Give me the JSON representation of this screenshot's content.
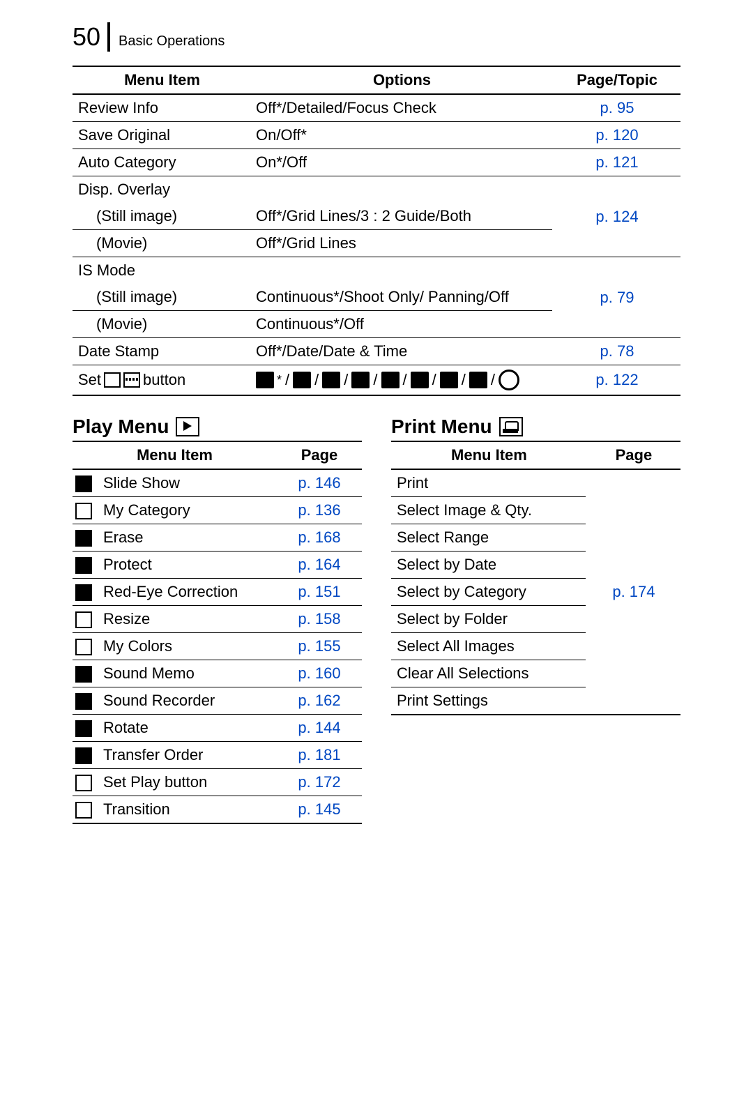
{
  "header": {
    "page_number": "50",
    "section": "Basic Operations"
  },
  "main_table": {
    "columns": [
      "Menu Item",
      "Options",
      "Page/Topic"
    ],
    "rows": [
      {
        "item": "Review Info",
        "options": "Off*/Detailed/Focus Check",
        "page": "p. 95"
      },
      {
        "item": "Save Original",
        "options": "On/Off*",
        "page": "p. 120"
      },
      {
        "item": "Auto Category",
        "options": "On*/Off",
        "page": "p. 121"
      },
      {
        "item": "Disp. Overlay",
        "group": true
      },
      {
        "item": "(Still image)",
        "indent": true,
        "options": "Off*/Grid Lines/3 : 2 Guide/Both",
        "page": "p. 124"
      },
      {
        "item": "(Movie)",
        "indent": true,
        "options": "Off*/Grid Lines"
      },
      {
        "item": "IS Mode",
        "group": true
      },
      {
        "item": "(Still image)",
        "indent": true,
        "options": "Continuous*/Shoot Only/ Panning/Off",
        "page": "p. 79"
      },
      {
        "item": "(Movie)",
        "indent": true,
        "options": "Continuous*/Off"
      },
      {
        "item": "Date Stamp",
        "options": "Off*/Date/Date & Time",
        "page": "p. 78"
      },
      {
        "item_prefix": "Set",
        "item_suffix": "button",
        "icon_row": true,
        "page": "p. 122"
      }
    ]
  },
  "play_menu": {
    "title": "Play Menu",
    "columns": [
      "Menu Item",
      "Page"
    ],
    "rows": [
      {
        "icon": "slideshow",
        "label": "Slide Show",
        "page": "p. 146"
      },
      {
        "icon": "category",
        "label": "My Category",
        "page": "p. 136",
        "inv": true
      },
      {
        "icon": "erase",
        "label": "Erase",
        "page": "p. 168"
      },
      {
        "icon": "protect",
        "label": "Protect",
        "page": "p. 164"
      },
      {
        "icon": "redeye",
        "label": "Red-Eye Correction",
        "page": "p. 151"
      },
      {
        "icon": "resize",
        "label": "Resize",
        "page": "p. 158",
        "inv": true
      },
      {
        "icon": "mycolors",
        "label": "My Colors",
        "page": "p. 155",
        "inv": true
      },
      {
        "icon": "soundmemo",
        "label": "Sound Memo",
        "page": "p. 160"
      },
      {
        "icon": "soundrec",
        "label": "Sound Recorder",
        "page": "p. 162"
      },
      {
        "icon": "rotate",
        "label": "Rotate",
        "page": "p. 144"
      },
      {
        "icon": "transfer",
        "label": "Transfer Order",
        "page": "p. 181"
      },
      {
        "icon": "playbtn",
        "label": "Set Play button",
        "page": "p. 172",
        "inv": true
      },
      {
        "icon": "transition",
        "label": "Transition",
        "page": "p. 145",
        "inv": true
      }
    ]
  },
  "print_menu": {
    "title": "Print Menu",
    "columns": [
      "Menu Item",
      "Page"
    ],
    "page": "p. 174",
    "rows": [
      {
        "label": "Print"
      },
      {
        "label": "Select Image & Qty."
      },
      {
        "label": "Select Range"
      },
      {
        "label": "Select by Date"
      },
      {
        "label": "Select by Category"
      },
      {
        "label": "Select by Folder"
      },
      {
        "label": "Select All Images"
      },
      {
        "label": "Clear All Selections"
      },
      {
        "label": "Print Settings"
      }
    ]
  }
}
